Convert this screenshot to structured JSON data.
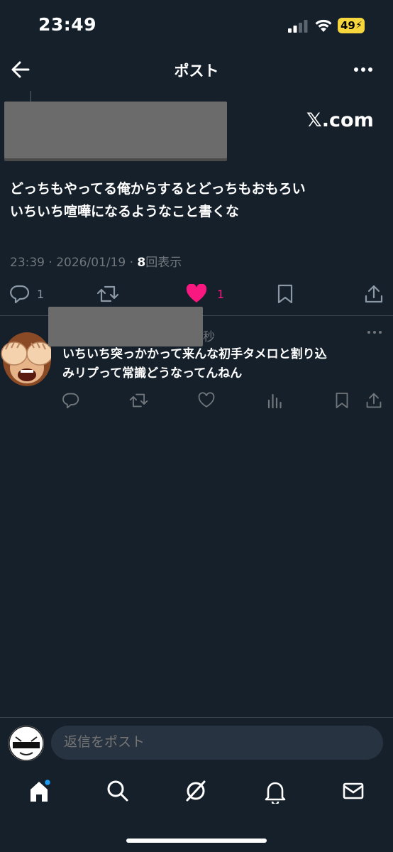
{
  "status_bar": {
    "time": "23:49",
    "battery": "49"
  },
  "header": {
    "title": "ポスト"
  },
  "post": {
    "source_label": "𝕏.com",
    "text_line1": "どっちもやってる俺からするとどっちもおもろい",
    "text_line2": "いちいち喧嘩になるようなこと書くな",
    "timestamp": "23:39 · 2026/01/19 · ",
    "views_count": "8",
    "views_label": "回表示",
    "reply_count": "1",
    "like_count": "1"
  },
  "reply": {
    "time": "秒",
    "text_line1": "いちいち突っかかって来んな初手タメロと割り込",
    "text_line2": "みリプって常識どうなってんねん"
  },
  "compose": {
    "placeholder": "返信をポスト"
  },
  "colors": {
    "background": "#15202b",
    "like": "#f91880",
    "muted": "#71767b",
    "accent": "#1d9bf0"
  },
  "icons": [
    "back-arrow-icon",
    "more-icon",
    "reply-icon",
    "retweet-icon",
    "heart-icon",
    "bookmark-icon",
    "share-icon",
    "views-icon",
    "home-icon",
    "search-icon",
    "grok-icon",
    "bell-icon",
    "mail-icon"
  ]
}
